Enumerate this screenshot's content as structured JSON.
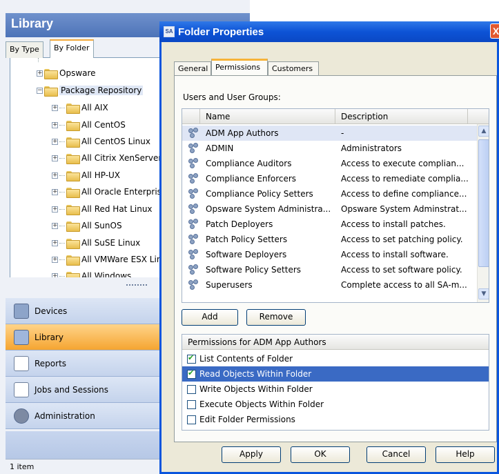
{
  "library": {
    "title": "Library",
    "tabs": [
      "By Type",
      "By Folder"
    ],
    "tree": [
      {
        "label": "Opsware",
        "level": 1,
        "expander": "+"
      },
      {
        "label": "Package Repository",
        "level": 1,
        "expander": "−"
      },
      {
        "label": "All AIX",
        "level": 2,
        "expander": "+"
      },
      {
        "label": "All CentOS",
        "level": 2,
        "expander": "+"
      },
      {
        "label": "All CentOS Linux",
        "level": 2,
        "expander": "+"
      },
      {
        "label": "All Citrix XenServer",
        "level": 2,
        "expander": "+"
      },
      {
        "label": "All HP-UX",
        "level": 2,
        "expander": "+"
      },
      {
        "label": "All Oracle Enterprise",
        "level": 2,
        "expander": "+"
      },
      {
        "label": "All Red Hat Linux",
        "level": 2,
        "expander": "+"
      },
      {
        "label": "All SunOS",
        "level": 2,
        "expander": "+"
      },
      {
        "label": "All SuSE Linux",
        "level": 2,
        "expander": "+"
      },
      {
        "label": "All VMWare ESX Linu",
        "level": 2,
        "expander": "+"
      },
      {
        "label": "All Windows",
        "level": 2,
        "expander": "+"
      }
    ],
    "nav": [
      {
        "label": "Devices",
        "icon": "devices-icon"
      },
      {
        "label": "Library",
        "icon": "library-icon",
        "active": true
      },
      {
        "label": "Reports",
        "icon": "reports-icon"
      },
      {
        "label": "Jobs and Sessions",
        "icon": "jobs-icon"
      },
      {
        "label": "Administration",
        "icon": "administration-icon"
      }
    ],
    "status": "1 item"
  },
  "dialog": {
    "title": "Folder Properties",
    "close": "X",
    "tabs": [
      "General",
      "Permissions",
      "Customers"
    ],
    "users_label": "Users and User Groups:",
    "columns": [
      "Name",
      "Description"
    ],
    "rows": [
      {
        "name": "ADM App Authors",
        "description": "-"
      },
      {
        "name": "ADMIN",
        "description": "Administrators"
      },
      {
        "name": "Compliance Auditors",
        "description": "Access to execute complian..."
      },
      {
        "name": "Compliance Enforcers",
        "description": "Access to remediate complia..."
      },
      {
        "name": "Compliance Policy Setters",
        "description": "Access to define compliance..."
      },
      {
        "name": "Opsware System Administra...",
        "description": "Opsware System Adminstrat..."
      },
      {
        "name": "Patch Deployers",
        "description": "Access to install patches."
      },
      {
        "name": "Patch Policy Setters",
        "description": "Access to set patching policy."
      },
      {
        "name": "Software Deployers",
        "description": "Access to install software."
      },
      {
        "name": "Software Policy Setters",
        "description": "Access to set software policy."
      },
      {
        "name": "Superusers",
        "description": "Complete access to all SA-m..."
      }
    ],
    "add_label": "Add",
    "remove_label": "Remove",
    "permissions_header": "Permissions for ADM App Authors",
    "permissions": [
      {
        "label": "List Contents of Folder",
        "checked": true
      },
      {
        "label": "Read Objects Within Folder",
        "checked": true,
        "selected": true
      },
      {
        "label": "Write Objects Within Folder",
        "checked": false
      },
      {
        "label": "Execute Objects Within Folder",
        "checked": false
      },
      {
        "label": "Edit Folder Permissions",
        "checked": false
      }
    ],
    "buttons": [
      "Apply",
      "OK",
      "Cancel",
      "Help"
    ]
  },
  "colors": {
    "accent": "#0a55dd",
    "selection": "#3a6ac4",
    "nav_active": "#f5a531"
  }
}
